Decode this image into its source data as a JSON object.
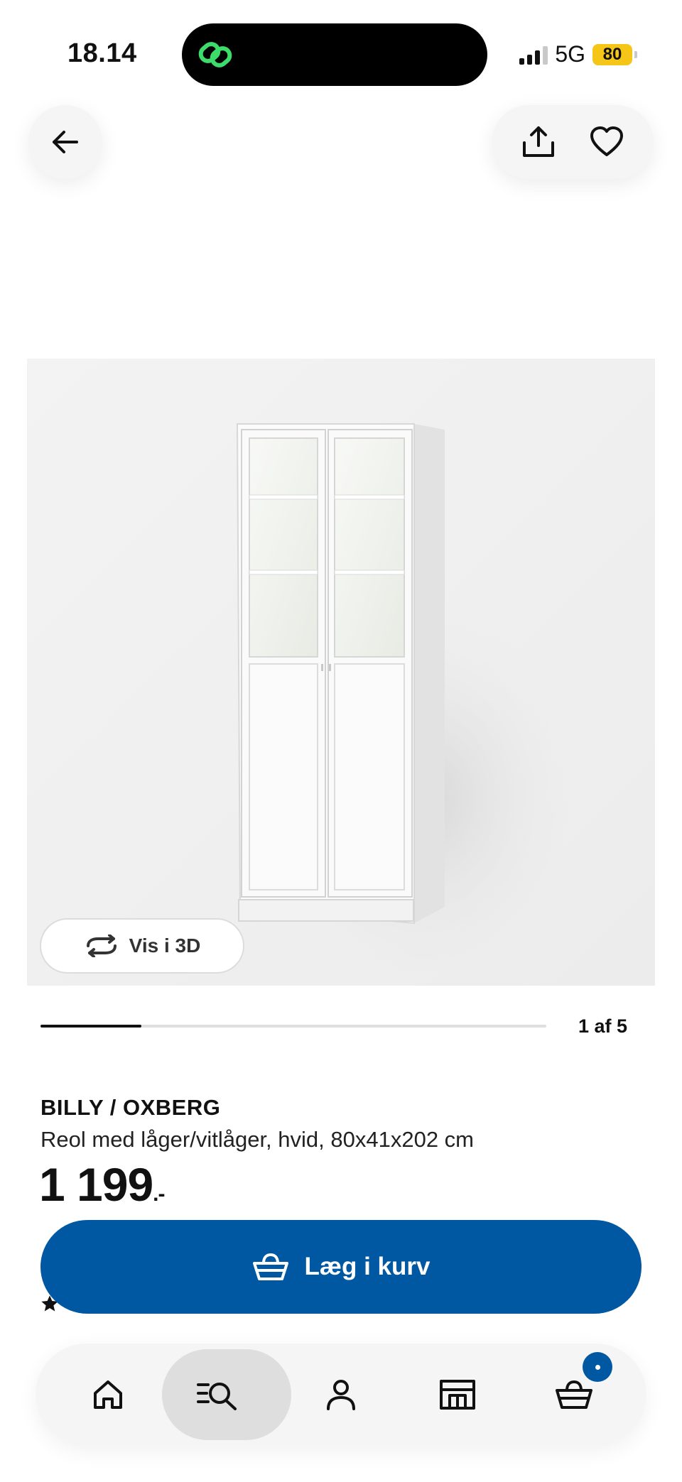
{
  "status_bar": {
    "time": "18.14",
    "network": "5G",
    "battery": "80",
    "signal_bars": 4,
    "signal_active": 3
  },
  "top_nav": {
    "back_icon": "arrow-left-icon",
    "share_icon": "share-icon",
    "favorite_icon": "heart-icon"
  },
  "gallery": {
    "view_3d_label": "Vis i 3D",
    "counter": "1 af 5",
    "current": 1,
    "total": 5
  },
  "product": {
    "name": "BILLY / OXBERG",
    "description": "Reol med låger/vitlåger, hvid, 80x41x202 cm",
    "price": "1 199",
    "price_suffix": ".-",
    "rating_icon": "star-icon"
  },
  "actions": {
    "add_to_cart_label": "Læg i kurv",
    "add_to_cart_icon": "basket-icon",
    "accent_color": "#0058a3"
  },
  "tab_bar": {
    "tabs": [
      {
        "name": "home",
        "icon": "home-icon"
      },
      {
        "name": "search",
        "icon": "search-list-icon",
        "active": true
      },
      {
        "name": "profile",
        "icon": "person-icon"
      },
      {
        "name": "store",
        "icon": "store-icon"
      },
      {
        "name": "cart",
        "icon": "basket-icon",
        "badge": true
      }
    ]
  }
}
